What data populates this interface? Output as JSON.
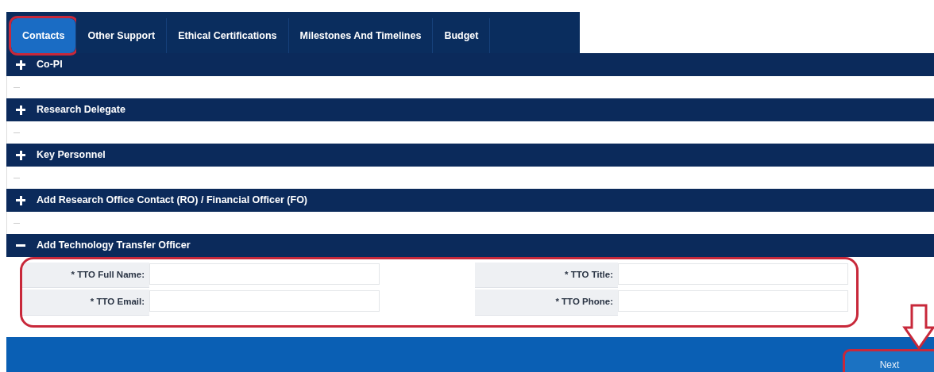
{
  "tabs": [
    {
      "label": "Contacts",
      "selected": true,
      "highlighted": true
    },
    {
      "label": "Other Support",
      "selected": false,
      "highlighted": false
    },
    {
      "label": "Ethical Certifications",
      "selected": false,
      "highlighted": false
    },
    {
      "label": "Milestones And Timelines",
      "selected": false,
      "highlighted": false
    },
    {
      "label": "Budget",
      "selected": false,
      "highlighted": false
    }
  ],
  "sections": [
    {
      "title": "Co-PI",
      "expanded": false
    },
    {
      "title": "Research Delegate",
      "expanded": false
    },
    {
      "title": "Key Personnel",
      "expanded": false
    },
    {
      "title": "Add Research Office Contact (RO) / Financial Officer (FO)",
      "expanded": false
    },
    {
      "title": "Add Technology Transfer Officer",
      "expanded": true,
      "highlighted": true,
      "fields": [
        {
          "label": "* TTO Full Name:"
        },
        {
          "label": "* TTO Title:"
        },
        {
          "label": "* TTO Email:"
        },
        {
          "label": "* TTO Phone:"
        }
      ]
    }
  ],
  "next_button": {
    "label": "Next",
    "highlighted": true
  }
}
